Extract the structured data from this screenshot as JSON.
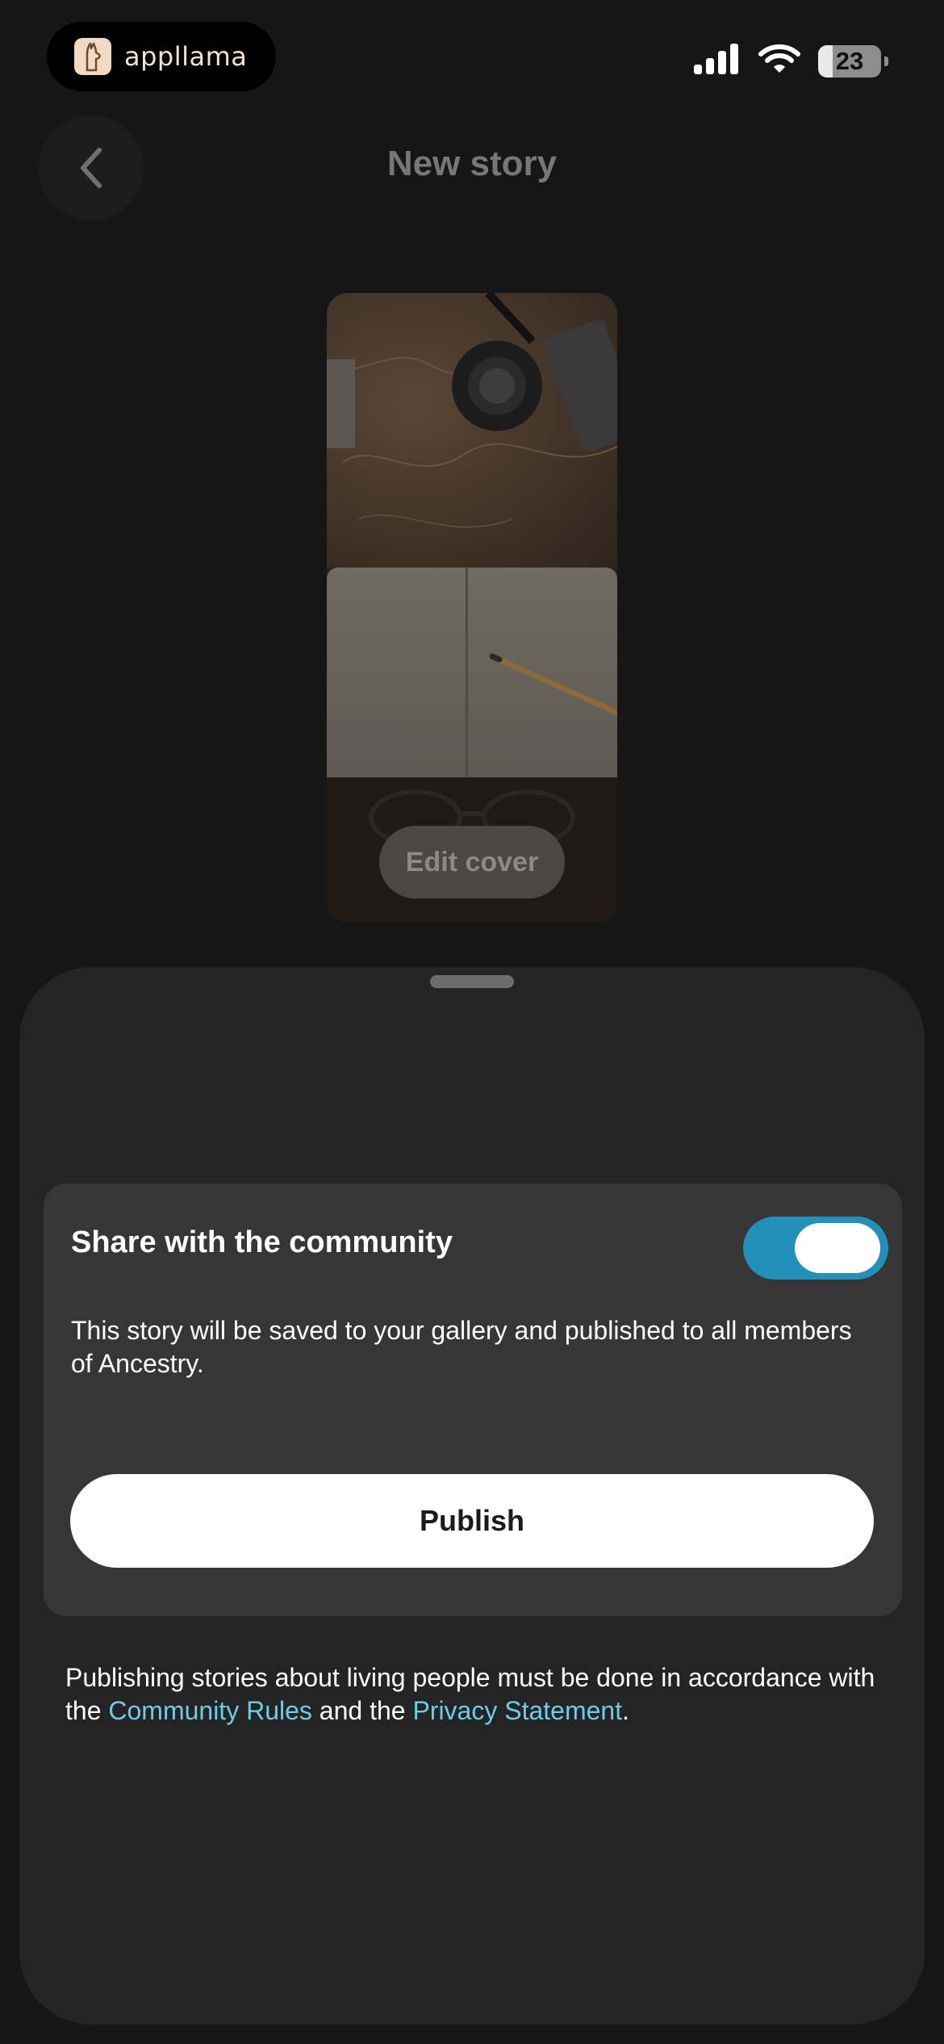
{
  "status_bar": {
    "brand_name": "appllama",
    "battery_level": "23",
    "icons": [
      "signal-icon",
      "wifi-icon",
      "battery-icon"
    ]
  },
  "header": {
    "title": "New story",
    "back_icon": "chevron-left-icon"
  },
  "cover": {
    "edit_label": "Edit cover"
  },
  "share_card": {
    "title": "Share with the community",
    "toggle_on": true,
    "description": "This story will be saved to your gallery and published to all members of Ancestry.",
    "publish_label": "Publish"
  },
  "disclaimer": {
    "text_before": "Publishing stories about living people must be done in accordance with the ",
    "link_community": "Community Rules",
    "text_middle": " and the ",
    "link_privacy": "Privacy Statement",
    "text_after": "."
  },
  "colors": {
    "background": "#161616",
    "sheet": "#242424",
    "card": "#363636",
    "toggle_accent": "#2290b8",
    "link": "#6fcbe6"
  }
}
